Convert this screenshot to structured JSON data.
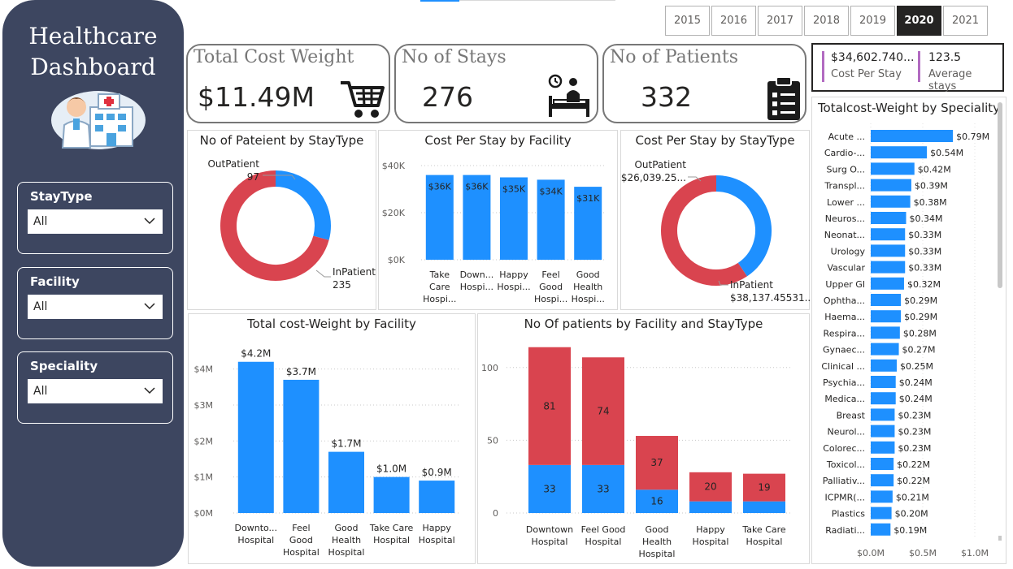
{
  "sidebar": {
    "title_line1": "Healthcare",
    "title_line2": "Dashboard",
    "filters": [
      {
        "label": "StayType",
        "value": "All"
      },
      {
        "label": "Facility",
        "value": "All"
      },
      {
        "label": "Speciality",
        "value": "All"
      }
    ]
  },
  "years": [
    "2015",
    "2016",
    "2017",
    "2018",
    "2019",
    "2020",
    "2021"
  ],
  "selected_year": "2020",
  "kpis": {
    "total_cost": {
      "title": "Total Cost Weight",
      "value": "$11.49M"
    },
    "stays": {
      "title": "No of Stays",
      "value": "276"
    },
    "patients": {
      "title": "No of Patients",
      "value": "332"
    }
  },
  "summary": {
    "cost_per_stay_value": "$34,602.740...",
    "cost_per_stay_label": "Cost Per Stay",
    "avg_stays_value": "123.5",
    "avg_stays_label": "Average stays"
  },
  "colors": {
    "blue": "#1e90ff",
    "red": "#d9444f",
    "sidebar": "#3d4660",
    "kpi_accent": "#b26ac1"
  },
  "chart_data": [
    {
      "id": "patients_by_staytype",
      "type": "pie",
      "title": "No of Pateient by StayType",
      "labels": [
        "OutPatient",
        "InPatient"
      ],
      "values": [
        97,
        235
      ],
      "label_texts": [
        "97",
        "235"
      ]
    },
    {
      "id": "cost_per_stay_by_facility",
      "type": "bar",
      "title": "Cost Per Stay by Facility",
      "categories": [
        [
          "Take",
          "Care",
          "Hospi..."
        ],
        [
          "Down...",
          "Hospi..."
        ],
        [
          "Happy",
          "Hospi..."
        ],
        [
          "Feel",
          "Good",
          "Hospi..."
        ],
        [
          "Good",
          "Health",
          "Hospi..."
        ]
      ],
      "values": [
        36000,
        36000,
        35000,
        34000,
        31000
      ],
      "data_labels": [
        "$36K",
        "$36K",
        "$35K",
        "$34K",
        "$31K"
      ],
      "yticks": [
        "$0K",
        "$20K",
        "$40K"
      ],
      "ylim": [
        0,
        40000
      ]
    },
    {
      "id": "cost_per_stay_by_staytype",
      "type": "pie",
      "title": "Cost Per Stay by StayType",
      "labels": [
        "OutPatient",
        "InPatient"
      ],
      "values": [
        26039.25,
        38137.45531
      ],
      "label_texts": [
        "$26,039.25...",
        "$38,137.45531..."
      ]
    },
    {
      "id": "cost_weight_by_facility",
      "type": "bar",
      "title": "Total cost-Weight by Facility",
      "categories": [
        [
          "Downto...",
          "Hospital"
        ],
        [
          "Feel",
          "Good",
          "Hospital"
        ],
        [
          "Good",
          "Health",
          "Hospital"
        ],
        [
          "Take Care",
          "Hospital"
        ],
        [
          "Happy",
          "Hospital"
        ]
      ],
      "values": [
        4.2,
        3.7,
        1.7,
        1.0,
        0.9
      ],
      "data_labels": [
        "$4.2M",
        "$3.7M",
        "$1.7M",
        "$1.0M",
        "$0.9M"
      ],
      "yticks": [
        "$0M",
        "$1M",
        "$2M",
        "$3M",
        "$4M"
      ],
      "ylim": [
        0,
        4.6
      ]
    },
    {
      "id": "patients_by_facility_staytype",
      "type": "bar",
      "title": "No Of patients by Facility and StayType",
      "categories": [
        [
          "Downtown",
          "Hospital"
        ],
        [
          "Feel Good",
          "Hospital"
        ],
        [
          "Good",
          "Health",
          "Hospital"
        ],
        [
          "Happy",
          "Hospital"
        ],
        [
          "Take Care",
          "Hospital"
        ]
      ],
      "series": [
        {
          "values": [
            33,
            33,
            16,
            8,
            8
          ],
          "labels": [
            "33",
            "33",
            "16",
            "",
            ""
          ]
        },
        {
          "values": [
            81,
            74,
            37,
            20,
            19
          ],
          "labels": [
            "81",
            "74",
            "37",
            "20",
            "19"
          ]
        }
      ],
      "yticks": [
        "0",
        "50",
        "100"
      ],
      "ylim": [
        0,
        125
      ]
    },
    {
      "id": "cost_weight_by_speciality",
      "type": "bar",
      "title": "Totalcost-Weight by Speciality",
      "categories": [
        "Acute ...",
        "Cardio-...",
        "Surg O...",
        "Transpl...",
        "Lower ...",
        "Neuros...",
        "Neonat...",
        "Urology",
        "Vascular",
        "Upper GI",
        "Ophtha...",
        "Haema...",
        "Respira...",
        "Gynaec...",
        "Clinical ...",
        "Psychia...",
        "Medica...",
        "Breast",
        "Neurol...",
        "Colorec...",
        "Toxicol...",
        "Palliativ...",
        "ICPMR(...",
        "Plastics",
        "Radiati..."
      ],
      "values": [
        0.79,
        0.54,
        0.42,
        0.39,
        0.38,
        0.34,
        0.33,
        0.33,
        0.33,
        0.32,
        0.29,
        0.29,
        0.28,
        0.27,
        0.25,
        0.24,
        0.24,
        0.23,
        0.23,
        0.23,
        0.22,
        0.22,
        0.21,
        0.2,
        0.19
      ],
      "data_labels": [
        "$0.79M",
        "$0.54M",
        "$0.42M",
        "$0.39M",
        "$0.38M",
        "$0.34M",
        "$0.33M",
        "$0.33M",
        "$0.33M",
        "$0.32M",
        "$0.29M",
        "$0.29M",
        "$0.28M",
        "$0.27M",
        "$0.25M",
        "$0.24M",
        "$0.24M",
        "$0.23M",
        "$0.23M",
        "$0.23M",
        "$0.22M",
        "$0.22M",
        "$0.21M",
        "$0.20M",
        "$0.19M"
      ],
      "xticks": [
        "$0.0M",
        "$0.5M",
        "$1.0M"
      ],
      "xlim": [
        0,
        1.0
      ]
    }
  ]
}
